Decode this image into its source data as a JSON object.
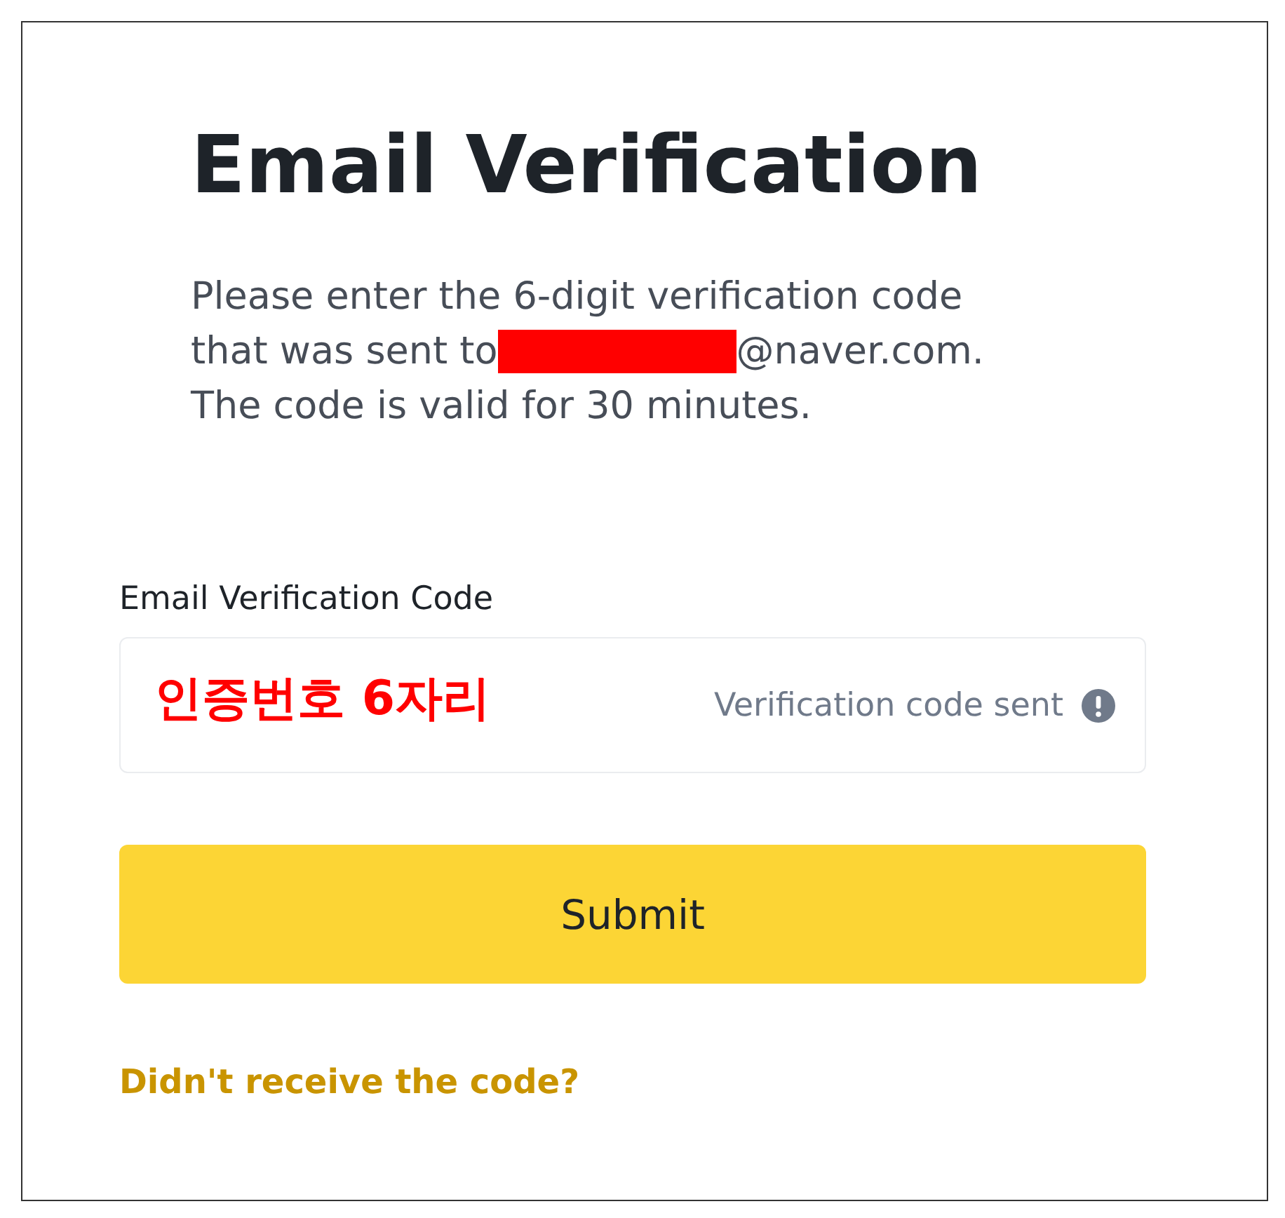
{
  "title": "Email Verification",
  "description": {
    "line_1": "Please enter the 6-digit verification code",
    "line_2_before": "that was sent to",
    "line_2_after": "@naver.com.",
    "line_3": "The code is valid for 30 minutes."
  },
  "field": {
    "label": "Email Verification Code",
    "annotation": "인증번호 6자리",
    "status": "Verification code sent"
  },
  "submit_button": "Submit",
  "resend_link": "Didn't receive the code?"
}
